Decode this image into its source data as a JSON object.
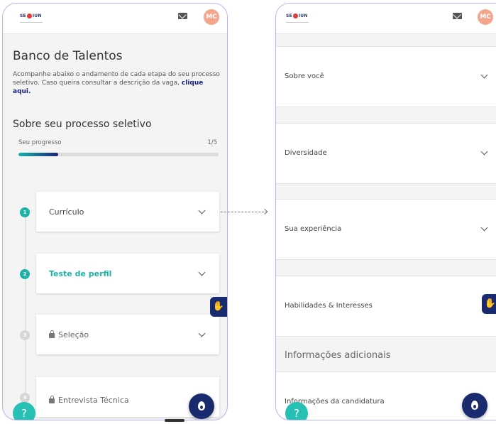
{
  "app": {
    "logo_text": "SENIUN",
    "user_initials": "MC"
  },
  "left_screen": {
    "title": "Banco de Talentos",
    "description": "Acompanhe abaixo o andamento de cada etapa do seu processo seletivo. Caso queira consultar a descrição da vaga,",
    "description_link": "clique aqui.",
    "section_title": "Sobre seu processo seletivo",
    "progress_label": "Seu progresso",
    "progress_count": "1/5",
    "progress_fraction": 0.2,
    "steps": [
      {
        "number": "1",
        "label": "Currículo",
        "state": "active"
      },
      {
        "number": "2",
        "label": "Teste de perfil",
        "state": "active"
      },
      {
        "number": "3",
        "label": "Seleção",
        "state": "locked"
      },
      {
        "number": "4",
        "label": "Entrevista Técnica",
        "state": "locked"
      }
    ]
  },
  "right_screen": {
    "sections": [
      {
        "label": "Sobre você"
      },
      {
        "label": "Diversidade"
      },
      {
        "label": "Sua experiência"
      },
      {
        "label": "Habilidades & Interesses"
      }
    ],
    "info_heading": "Informações adicionais",
    "candidatura_label": "Informações da candidatura"
  },
  "buttons": {
    "help_label": "?",
    "accessibility_icon": "hand-sign-icon",
    "chat_icon": "flame-icon"
  },
  "colors": {
    "teal": "#1ab3a6",
    "navy": "#1a2a6e",
    "avatar": "#f4a58b",
    "phone_border": "#b7b2f2"
  }
}
